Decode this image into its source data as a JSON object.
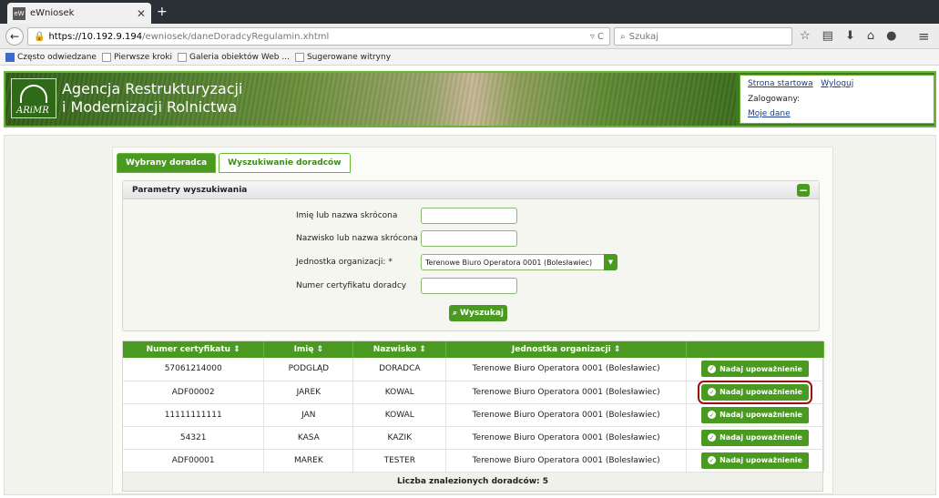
{
  "browser": {
    "tab_title": "eWniosek",
    "favicon_text": "eW",
    "url_host": "https://10.192.9.194",
    "url_path": "/ewniosek/daneDoradcyRegulamin.xhtml",
    "search_placeholder": "Szukaj",
    "bookmarks": [
      "Często odwiedzane",
      "Pierwsze kroki",
      "Galeria obiektów Web ...",
      "Sugerowane witryny"
    ]
  },
  "header": {
    "org_line1": "Agencja Restrukturyzacji",
    "org_line2": "i Modernizacji Rolnictwa",
    "logo_text": "ARiMR",
    "home_link": "Strona startowa",
    "logout_link": "Wyloguj",
    "logged_label": "Zalogowany:",
    "my_data_link": "Moje dane"
  },
  "tabs": [
    {
      "label": "Wybrany doradca"
    },
    {
      "label": "Wyszukiwanie doradców"
    }
  ],
  "search_panel": {
    "title": "Parametry wyszukiwania",
    "collapse_symbol": "−",
    "fields": {
      "name_label": "Imię lub nazwa skrócona",
      "surname_label": "Nazwisko lub nazwa skrócona",
      "unit_label": "Jednostka organizacji: *",
      "unit_value": "Terenowe Biuro Operatora 0001 (Bolesławiec)",
      "cert_label": "Numer certyfikatu doradcy"
    },
    "search_button": "Wyszukaj"
  },
  "table": {
    "headers": [
      "Numer certyfikatu ⇕",
      "Imię ⇕",
      "Nazwisko ⇕",
      "Jednostka organizacji ⇕"
    ],
    "action_label": "Nadaj upoważnienie",
    "rows": [
      {
        "cert": "57061214000",
        "first": "PODGLĄD",
        "last": "DORADCA",
        "unit": "Terenowe Biuro Operatora 0001 (Bolesławiec)"
      },
      {
        "cert": "ADF00002",
        "first": "JAREK",
        "last": "KOWAL",
        "unit": "Terenowe Biuro Operatora 0001 (Bolesławiec)"
      },
      {
        "cert": "11111111111",
        "first": "JAN",
        "last": "KOWAL",
        "unit": "Terenowe Biuro Operatora 0001 (Bolesławiec)"
      },
      {
        "cert": "54321",
        "first": "KASA",
        "last": "KAZIK",
        "unit": "Terenowe Biuro Operatora 0001 (Bolesławiec)"
      },
      {
        "cert": "ADF00001",
        "first": "MAREK",
        "last": "TESTER",
        "unit": "Terenowe Biuro Operatora 0001 (Bolesławiec)"
      }
    ],
    "count_text": "Liczba znalezionych doradców: 5"
  }
}
